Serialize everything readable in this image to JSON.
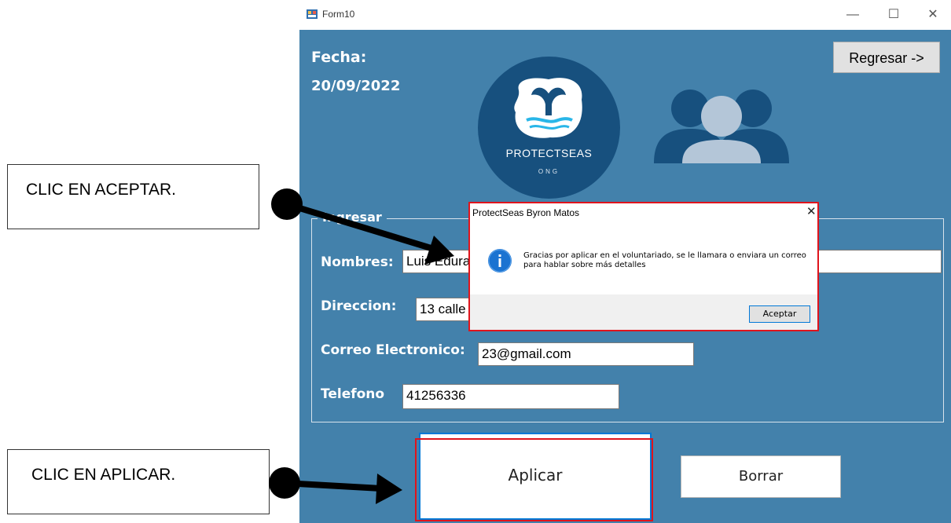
{
  "window": {
    "title": "Form10",
    "minimize": "—",
    "maximize": "☐",
    "close": "✕"
  },
  "form": {
    "fecha_label": "Fecha:",
    "fecha_value": "20/09/2022",
    "regresar_label": "Regresar ->",
    "logo_name": "PROTECTSEAS",
    "logo_sub": "ONG",
    "group_label": "Ingresar",
    "nombres_label": "Nombres:",
    "nombres_value": "Luis Edura",
    "direccion_label": "Direccion:",
    "direccion_value": "13 calle",
    "correo_label": "Correo Electronico:",
    "correo_value": "23@gmail.com",
    "telefono_label": "Telefono",
    "telefono_value": "41256336",
    "aplicar_label": "Aplicar",
    "borrar_label": "Borrar"
  },
  "messagebox": {
    "title": "ProtectSeas Byron Matos",
    "close": "✕",
    "message": "Gracias por aplicar en el voluntariado, se le llamara o enviara un correo para hablar sobre más detalles",
    "ok_label": "Aceptar"
  },
  "annotations": {
    "aceptar_callout": "CLIC EN ACEPTAR.",
    "aplicar_callout": "CLIC EN APLICAR."
  },
  "colors": {
    "form_bg": "#4381ab",
    "logo_bg": "#17507e",
    "highlight": "#e0141c",
    "accent": "#0078d7"
  },
  "icons": [
    "app-icon",
    "logo-whale-tail-icon",
    "users-icon",
    "info-icon"
  ]
}
